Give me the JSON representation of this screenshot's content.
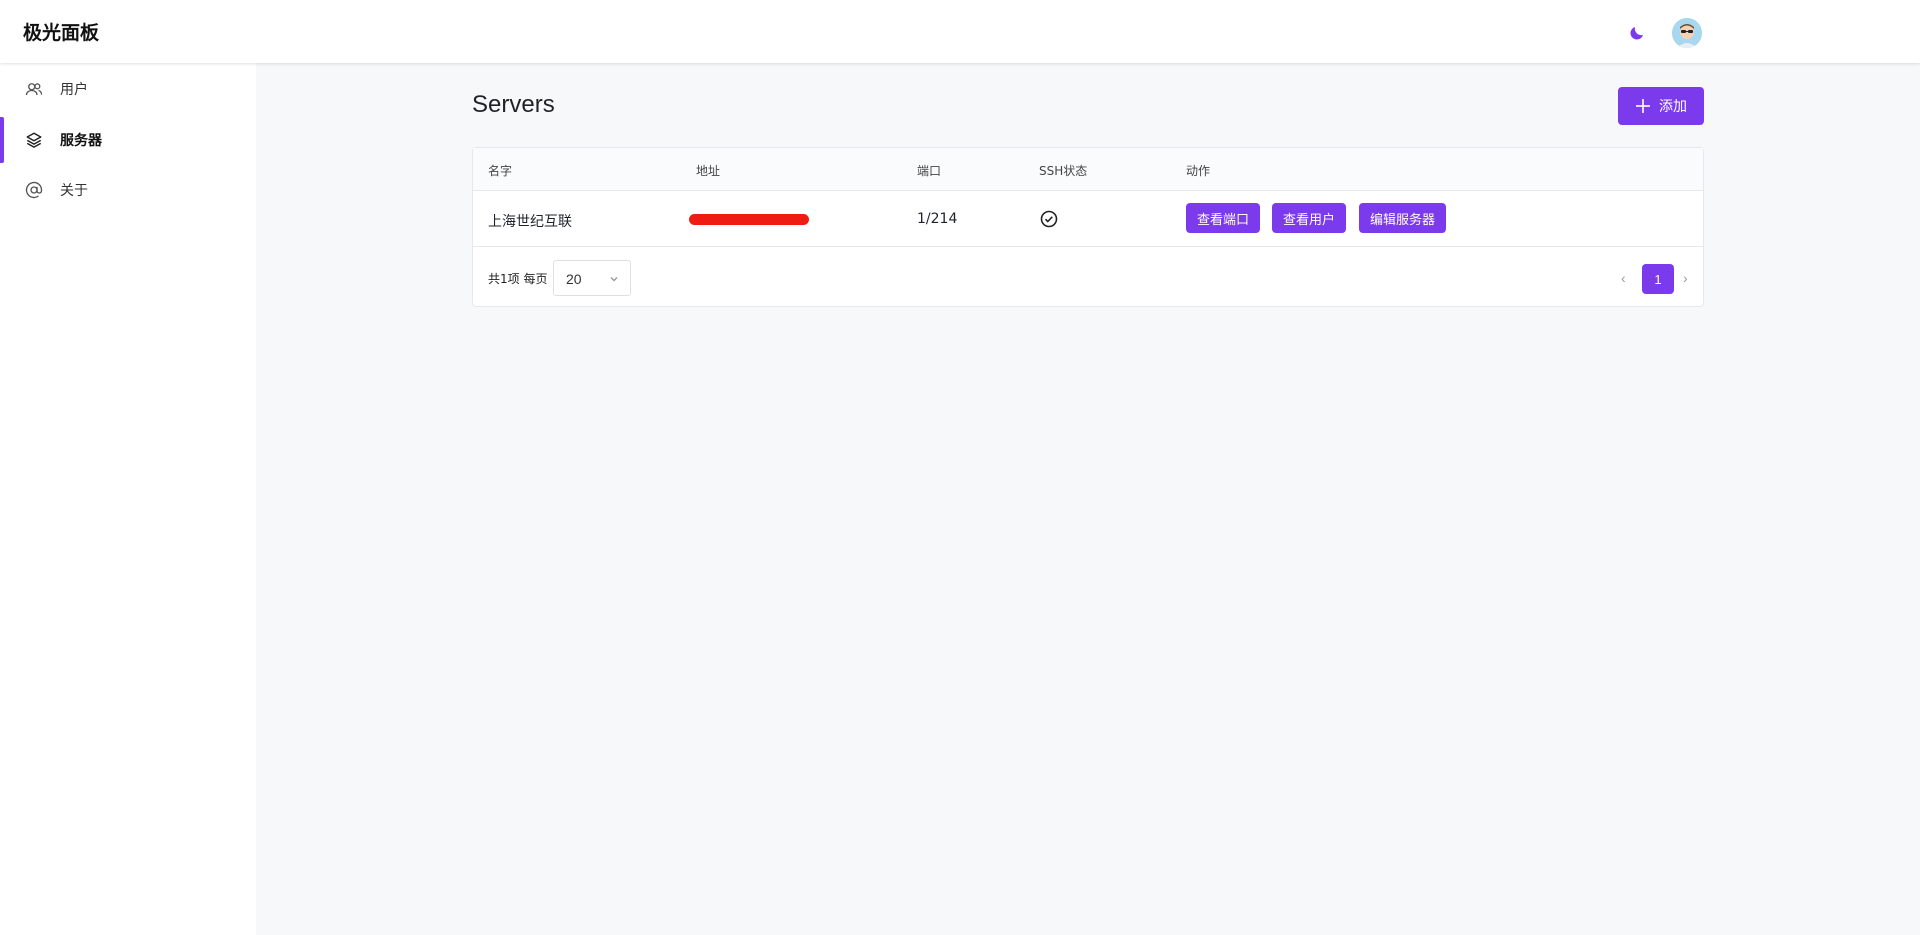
{
  "app": {
    "brand": "极光面板"
  },
  "header": {
    "theme_icon": "moon-icon",
    "avatar_icon": "user-avatar"
  },
  "sidebar": {
    "items": [
      {
        "label": "用户",
        "icon": "users-icon",
        "active": false
      },
      {
        "label": "服务器",
        "icon": "layers-icon",
        "active": true
      },
      {
        "label": "关于",
        "icon": "at-icon",
        "active": false
      }
    ]
  },
  "page": {
    "title": "Servers",
    "add_label": "添加"
  },
  "table": {
    "columns": [
      "名字",
      "地址",
      "端口",
      "SSH状态",
      "动作"
    ],
    "rows": [
      {
        "name": "上海世纪互联",
        "address": "",
        "ports": "1/214",
        "ssh_status": "ok",
        "actions": [
          "查看端口",
          "查看用户",
          "编辑服务器"
        ]
      }
    ]
  },
  "pagination": {
    "total_text": "共1项 每页",
    "page_size": "20",
    "current_page": "1",
    "prev": "‹",
    "next": "›"
  },
  "colors": {
    "accent": "#7c3aed",
    "redacted": "#ee1c13"
  }
}
